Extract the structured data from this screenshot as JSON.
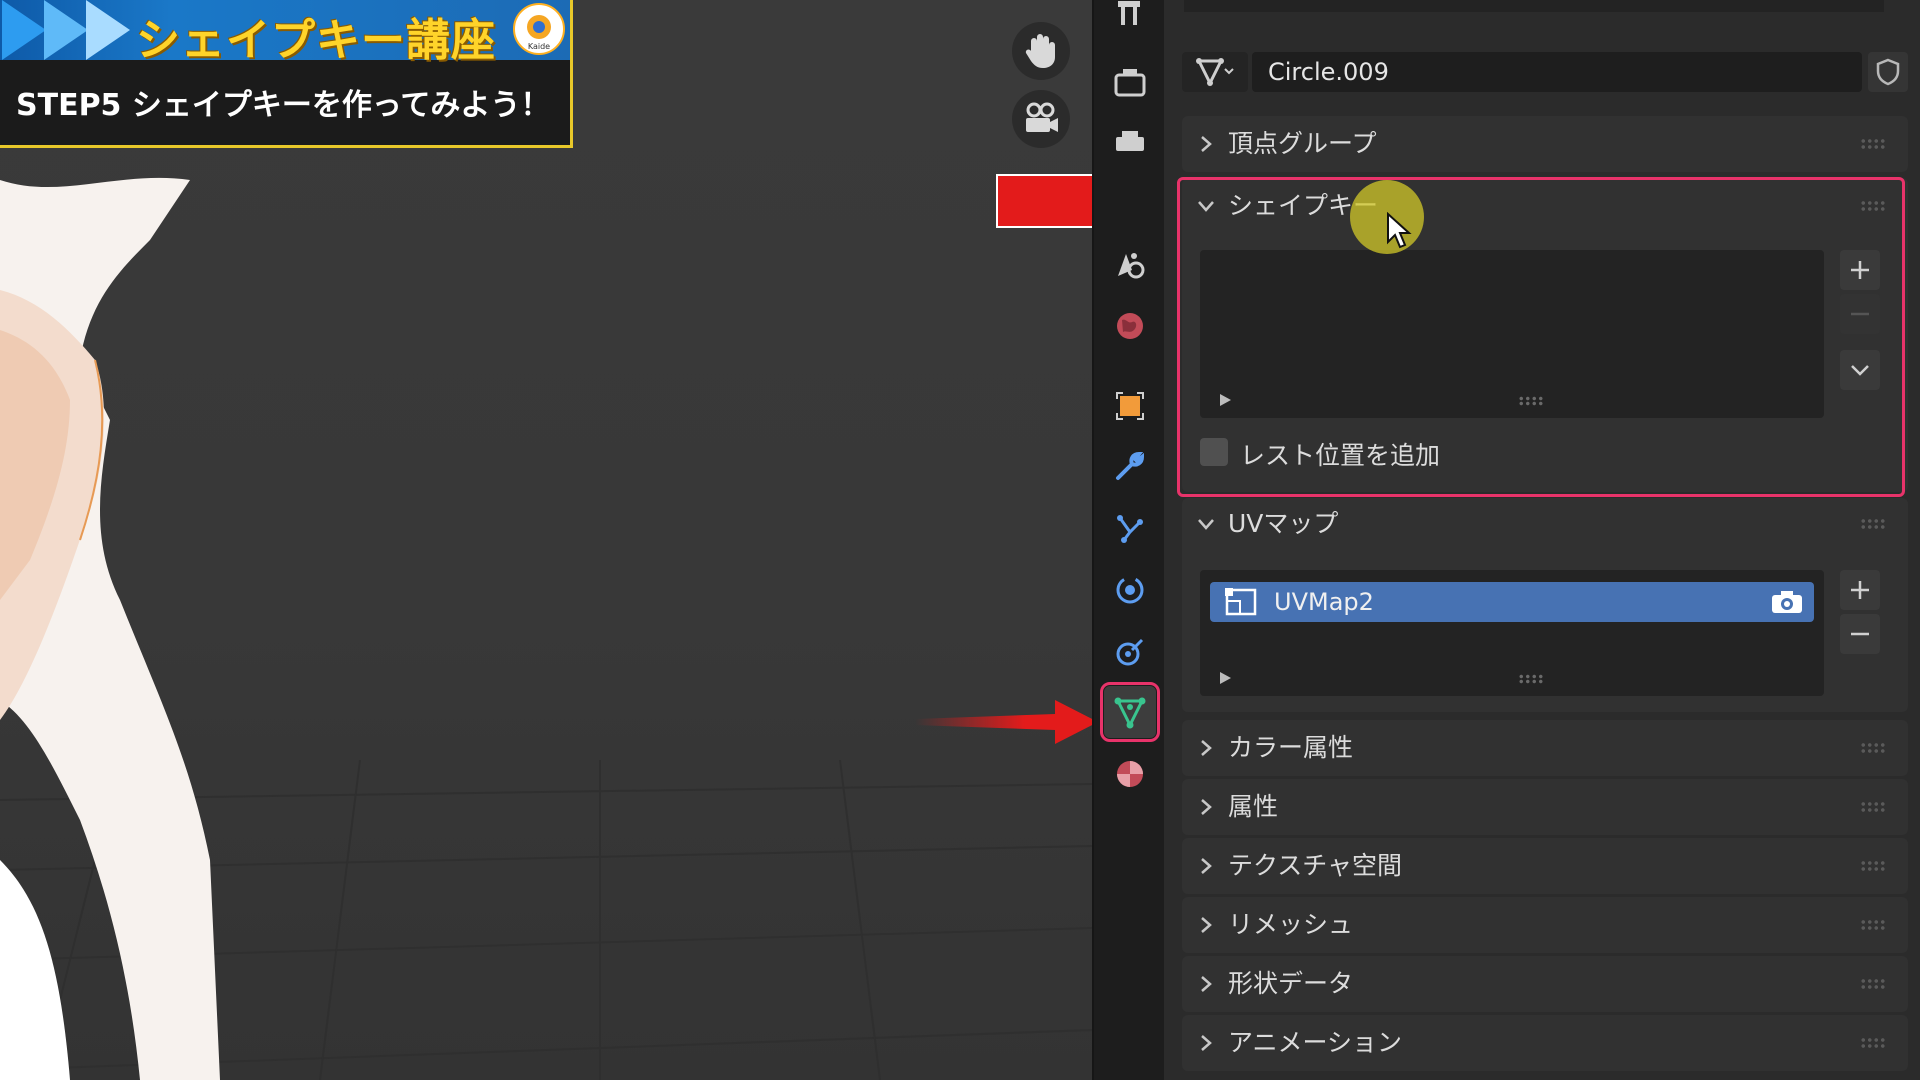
{
  "banner": {
    "title": "シェイプキー講座",
    "subtitle": "STEP5 シェイプキーを作ってみよう！",
    "logo_text": "Kaide"
  },
  "panel": {
    "mesh_name": "Circle.009",
    "sections": [
      {
        "id": "vertex-groups",
        "title": "頂点グループ",
        "expanded": false
      },
      {
        "id": "shape-keys",
        "title": "シェイプキー",
        "expanded": true
      },
      {
        "id": "uv-maps",
        "title": "UVマップ",
        "expanded": true
      },
      {
        "id": "color-attributes",
        "title": "カラー属性",
        "expanded": false
      },
      {
        "id": "attributes",
        "title": "属性",
        "expanded": false
      },
      {
        "id": "texture-space",
        "title": "テクスチャ空間",
        "expanded": false
      },
      {
        "id": "remesh",
        "title": "リメッシュ",
        "expanded": false
      },
      {
        "id": "geometry-data",
        "title": "形状データ",
        "expanded": false
      },
      {
        "id": "animation",
        "title": "アニメーション",
        "expanded": false
      }
    ],
    "shape_keys": {
      "rest_position_label": "レスト位置を追加",
      "rest_position_checked": false
    },
    "uv_maps": {
      "items": [
        {
          "name": "UVMap2",
          "selected": true
        }
      ]
    }
  },
  "colors": {
    "highlight": "#e8336a",
    "selection": "#4772b3",
    "banner_yellow": "#ffd42a",
    "arrow_red": "#e31b1b"
  }
}
